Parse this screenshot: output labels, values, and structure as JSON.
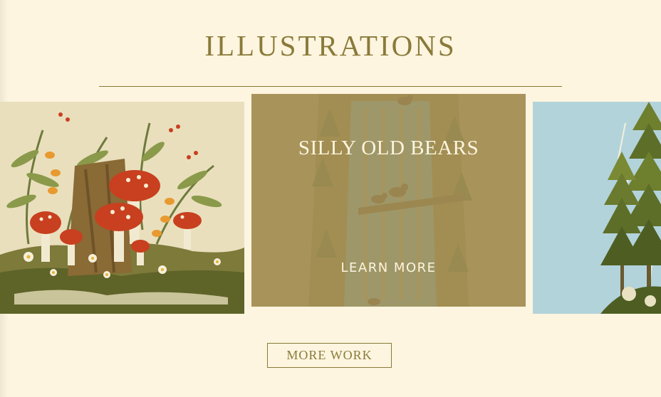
{
  "section": {
    "title": "ILLUSTRATIONS"
  },
  "carousel": {
    "featured": {
      "title": "SILLY OLD BEARS",
      "cta": "LEARN MORE"
    },
    "left_image_icon": "mushroom-illustration",
    "center_image_icon": "waterfall-bears-illustration",
    "right_image_icon": "pine-trees-illustration"
  },
  "footer": {
    "more_button": "MORE WORK"
  },
  "colors": {
    "background": "#fdf5df",
    "accent": "#8a7a3a",
    "overlay": "#a7935c",
    "mushroom_red": "#c8401f",
    "sky_blue": "#b3d3db"
  }
}
